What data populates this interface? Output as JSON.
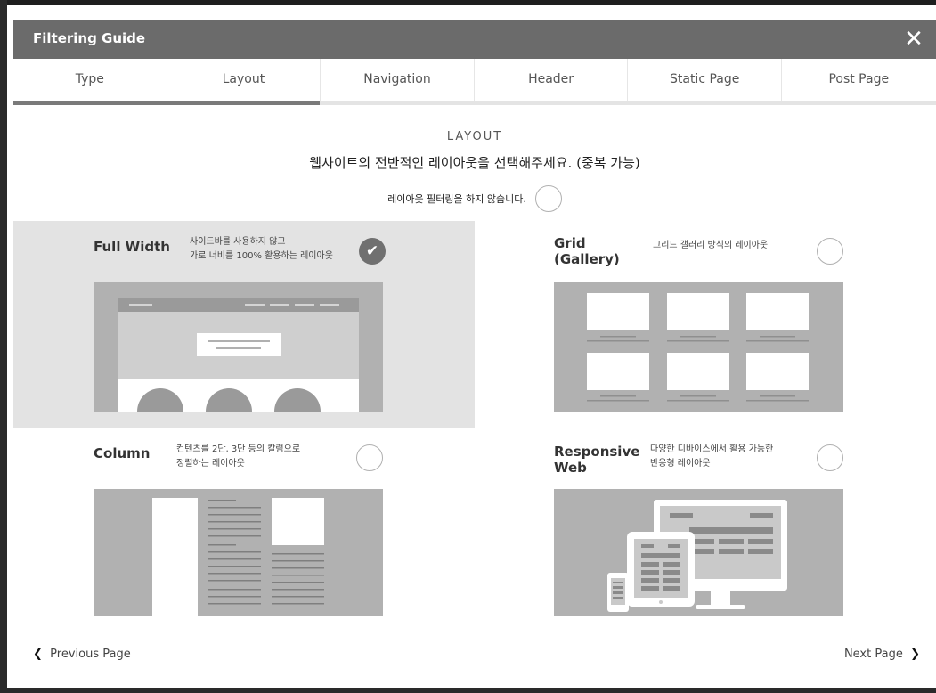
{
  "modal": {
    "title": "Filtering Guide",
    "close_icon": "close-icon"
  },
  "tabs": [
    {
      "label": "Type"
    },
    {
      "label": "Layout",
      "active": true
    },
    {
      "label": "Navigation"
    },
    {
      "label": "Header"
    },
    {
      "label": "Static Page"
    },
    {
      "label": "Post Page"
    }
  ],
  "section": {
    "label": "LAYOUT",
    "description": "웹사이트의 전반적인 레이아웃을 선택해주세요. (중복 가능)",
    "no_filter_label": "레이아웃 필터링을 하지 않습니다."
  },
  "options": [
    {
      "title": "Full Width",
      "desc_line1": "사이드바를 사용하지 않고",
      "desc_line2": "가로 너비를 100% 활용하는 레이아웃",
      "selected": true
    },
    {
      "title_line1": "Grid",
      "title_line2": "(Gallery)",
      "desc_line1": "그리드 갤러리 방식의 레이아웃",
      "desc_line2": "",
      "selected": false
    },
    {
      "title": "Column",
      "desc_line1": "컨텐츠를 2단, 3단 등의 칼럼으로",
      "desc_line2": "정렬하는 레이아웃",
      "selected": false
    },
    {
      "title_line1": "Responsive",
      "title_line2": "Web",
      "desc_line1": "다양한 디바이스에서 활용 가능한",
      "desc_line2": "반응형 레이아웃",
      "selected": false
    }
  ],
  "footer": {
    "prev_label": "Previous Page",
    "next_label": "Next Page"
  },
  "colors": {
    "header_bg": "#6b6b6b",
    "selected_bg": "#e3e3e3",
    "illustration_bg": "#b1b1b1",
    "check_bg": "#707070"
  }
}
